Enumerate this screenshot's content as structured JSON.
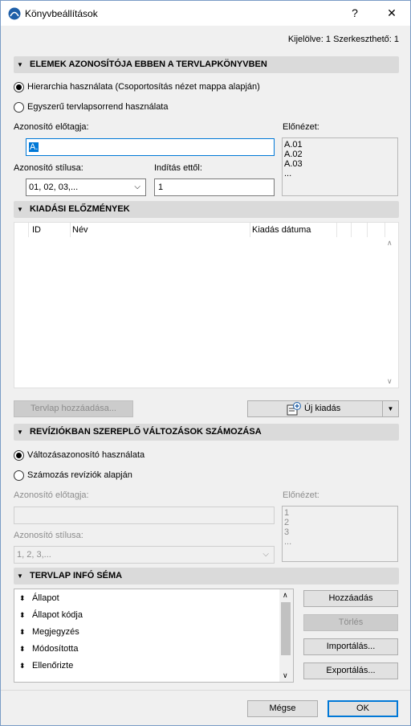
{
  "window": {
    "title": "Könyvbeállítások",
    "help_label": "?",
    "close_label": "✕"
  },
  "selection_info": "Kijelölve: 1 Szerkeszthető: 1",
  "sections": {
    "identification": "ELEMEK AZONOSÍTÓJA EBBEN A TERVLAPKÖNYVBEN",
    "issue_history": "KIADÁSI ELŐZMÉNYEK",
    "revision_numbering": "REVÍZIÓKBAN SZEREPLŐ VÁLTOZÁSOK SZÁMOZÁSA",
    "sheet_info": "TERVLAP INFÓ SÉMA"
  },
  "identification": {
    "radio_hierarchy": "Hierarchia használata (Csoportosítás nézet mappa alapján)",
    "radio_simple": "Egyszerű tervlapsorrend használata",
    "prefix_label": "Azonosító előtagja:",
    "prefix_value": "A.",
    "style_label": "Azonosító stílusa:",
    "style_value": "01, 02, 03,...",
    "start_label": "Indítás ettől:",
    "start_value": "1",
    "preview_label": "Előnézet:",
    "preview_lines": [
      "A.01",
      "A.02",
      "A.03",
      "..."
    ]
  },
  "issue_history": {
    "columns": [
      "ID",
      "Név",
      "Kiadás dátuma"
    ],
    "add_sheet_button": "Tervlap hozzáadása...",
    "new_issue_button": "Új kiadás"
  },
  "revision": {
    "radio_change_id": "Változásazonosító használata",
    "radio_by_revision": "Számozás revíziók alapján",
    "prefix_label": "Azonosító előtagja:",
    "prefix_value": "",
    "style_label": "Azonosító stílusa:",
    "style_value": "1, 2, 3,...",
    "preview_label": "Előnézet:",
    "preview_lines": [
      "1",
      "2",
      "3",
      "..."
    ]
  },
  "sheet_info": {
    "items": [
      "Állapot",
      "Állapot kódja",
      "Megjegyzés",
      "Módosította",
      "Ellenőrizte"
    ],
    "add_button": "Hozzáadás",
    "delete_button": "Törlés",
    "import_button": "Importálás...",
    "export_button": "Exportálás..."
  },
  "footer": {
    "cancel_button": "Mégse",
    "ok_button": "OK"
  },
  "colors": {
    "accent": "#0078d7",
    "section_bg": "#dadada",
    "dialog_bg": "#f0f0f0"
  }
}
